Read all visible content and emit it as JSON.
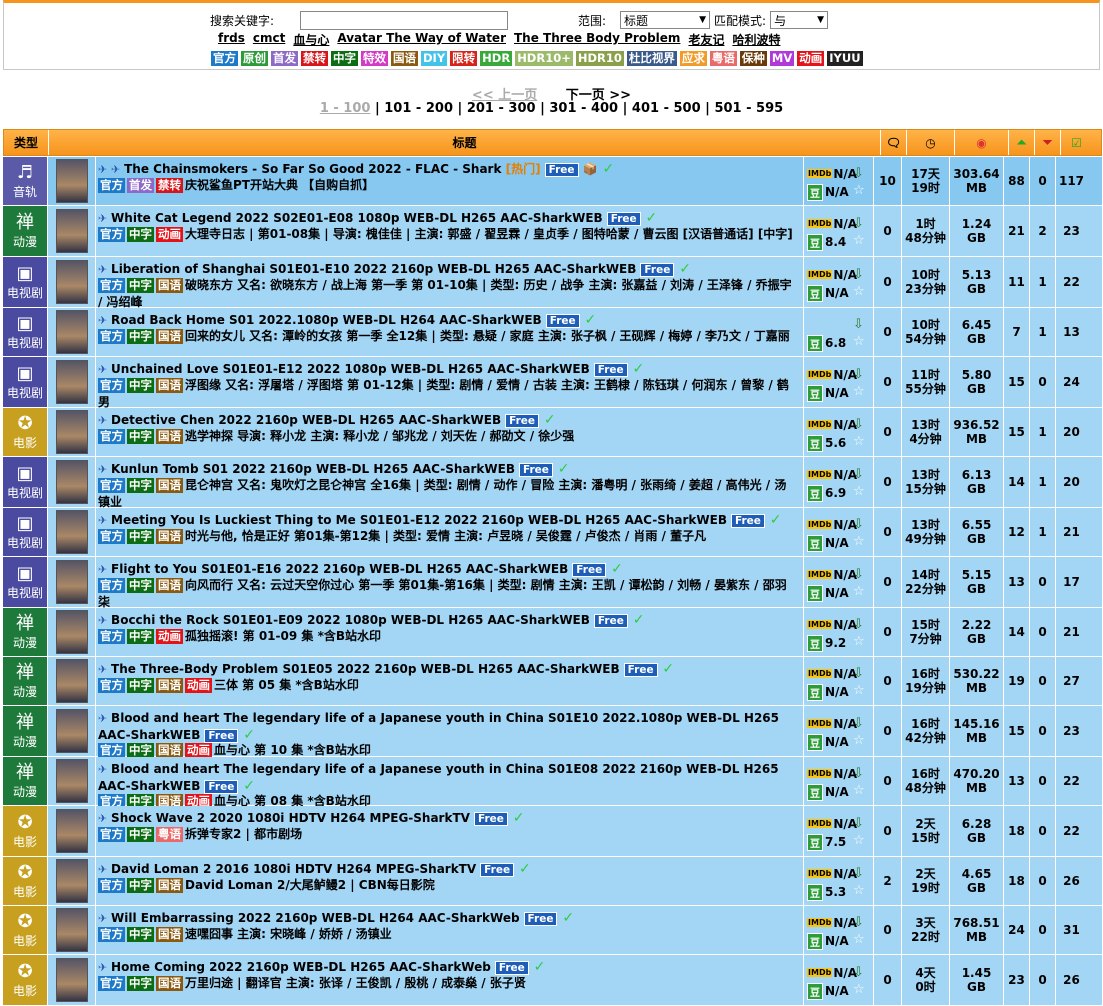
{
  "search": {
    "label": "搜索关键字:",
    "scope_label": "范围:",
    "scope_value": "标题",
    "mode_label": "匹配模式:",
    "mode_value": "与"
  },
  "hot": [
    "frds",
    "cmct",
    "血与心",
    "Avatar The Way of Water",
    "The Three Body Problem",
    "老友记",
    "哈利波特"
  ],
  "tags": [
    {
      "t": "官方",
      "c": "#1e7ac8"
    },
    {
      "t": "原创",
      "c": "#2c9c3a"
    },
    {
      "t": "首发",
      "c": "#8e6ac8"
    },
    {
      "t": "禁转",
      "c": "#d6161b"
    },
    {
      "t": "中字",
      "c": "#0d6d14"
    },
    {
      "t": "特效",
      "c": "#d43bc4"
    },
    {
      "t": "国语",
      "c": "#8a5a10"
    },
    {
      "t": "DIY",
      "c": "#43c3e8"
    },
    {
      "t": "限转",
      "c": "#d4241b"
    },
    {
      "t": "HDR",
      "c": "#39a93a"
    },
    {
      "t": "HDR10+",
      "c": "#9bba6a"
    },
    {
      "t": "HDR10",
      "c": "#8aa04a"
    },
    {
      "t": "杜比视界",
      "c": "#3a5a8a"
    },
    {
      "t": "应求",
      "c": "#f19c2a"
    },
    {
      "t": "粤语",
      "c": "#e86a6a"
    },
    {
      "t": "保种",
      "c": "#6a3a0a"
    },
    {
      "t": "MV",
      "c": "#b03ad8"
    },
    {
      "t": "动画",
      "c": "#e2141a"
    },
    {
      "t": "IYUU",
      "c": "#222"
    }
  ],
  "pager": {
    "prev": "<< 上一页",
    "next": "下一页 >>",
    "pages": [
      "1 - 100",
      "101 - 200",
      "201 - 300",
      "301 - 400",
      "401 - 500",
      "501 - 595"
    ]
  },
  "header": {
    "type": "类型",
    "title": "标题"
  },
  "rows": [
    {
      "cat": "音轨",
      "g": "♬",
      "cc": "#5a5aa8",
      "title": "The Chainsmokers - So Far So Good 2022 - FLAC - Shark",
      "hot": "[热门]",
      "sub": "庆祝鲨鱼PT开站大典 【自购自抓】",
      "tags": [
        "官方",
        "首发",
        "禁转"
      ],
      "imdb": "N/A",
      "db": "N/A",
      "c": "10",
      "time": "17天\n19时",
      "size": "303.64\nMB",
      "se": "88",
      "le": "0",
      "done": "117"
    },
    {
      "cat": "动漫",
      "g": "禅",
      "cc": "#1e7a3a",
      "title": "White Cat Legend 2022 S02E01-E08 1080p WEB-DL H265 AAC-SharkWEB",
      "sub": "大理寺日志 | 第01-08集 | 导演: 槐佳佳 | 主演: 郭盛 / 翟昱霖 / 皇贞季 / 图特哈蒙 / 曹云图 [汉语普通话] [中字]",
      "tags": [
        "官方",
        "中字",
        "动画"
      ],
      "imdb": "N/A",
      "db": "8.4",
      "c": "0",
      "time": "1时\n48分钟",
      "size": "1.24\nGB",
      "se": "21",
      "le": "2",
      "done": "23"
    },
    {
      "cat": "电视剧",
      "g": "▣",
      "cc": "#4a4aa0",
      "title": "Liberation of Shanghai S01E01-E10 2022 2160p WEB-DL H265 AAC-SharkWEB",
      "sub": "破晓东方 又名: 欲晓东方 / 战上海 第一季 第 01-10集 | 类型: 历史 / 战争 主演: 张嘉益 / 刘涛 / 王泽锋 / 乔振宇 / 冯绍峰",
      "tags": [
        "官方",
        "中字",
        "国语"
      ],
      "imdb": "N/A",
      "db": "N/A",
      "c": "0",
      "time": "10时\n23分钟",
      "size": "5.13\nGB",
      "se": "11",
      "le": "1",
      "done": "22"
    },
    {
      "cat": "电视剧",
      "g": "▣",
      "cc": "#4a4aa0",
      "title": "Road Back Home S01 2022.1080p WEB-DL H264 AAC-SharkWEB",
      "sub": "回来的女儿 又名: 潭岭的女孩 第一季 全12集 | 类型: 悬疑 / 家庭 主演: 张子枫 / 王砚辉 / 梅婷 / 李乃文 / 丁嘉丽",
      "tags": [
        "官方",
        "中字",
        "国语"
      ],
      "imdb": "",
      "db": "6.8",
      "c": "0",
      "time": "10时\n54分钟",
      "size": "6.45\nGB",
      "se": "7",
      "le": "1",
      "done": "13"
    },
    {
      "cat": "电视剧",
      "g": "▣",
      "cc": "#4a4aa0",
      "title": "Unchained Love S01E01-E12 2022 1080p WEB-DL H265 AAC-SharkWEB",
      "sub": "浮图缘 又名: 浮屠塔 / 浮图塔 第 01-12集 | 类型: 剧情 / 爱情 / 古装 主演: 王鹤棣 / 陈钰琪 / 何润东 / 曾黎 / 鹤男",
      "tags": [
        "官方",
        "中字",
        "国语"
      ],
      "imdb": "N/A",
      "db": "N/A",
      "c": "0",
      "time": "11时\n55分钟",
      "size": "5.80\nGB",
      "se": "15",
      "le": "0",
      "done": "24"
    },
    {
      "cat": "电影",
      "g": "✪",
      "cc": "#c8a020",
      "title": "Detective Chen 2022 2160p WEB-DL H265 AAC-SharkWEB",
      "sub": "逃学神探 导演: 释小龙 主演: 释小龙 / 邹兆龙 / 刘天佐 / 郝劭文 / 徐少强",
      "tags": [
        "官方",
        "中字",
        "国语"
      ],
      "imdb": "N/A",
      "db": "5.6",
      "c": "0",
      "time": "13时\n4分钟",
      "size": "936.52\nMB",
      "se": "15",
      "le": "1",
      "done": "20"
    },
    {
      "cat": "电视剧",
      "g": "▣",
      "cc": "#4a4aa0",
      "title": "Kunlun Tomb S01 2022 2160p WEB-DL H265 AAC-SharkWEB",
      "sub": "昆仑神宫 又名: 鬼吹灯之昆仑神宫 全16集 | 类型: 剧情 / 动作 / 冒险 主演: 潘粤明 / 张雨绮 / 姜超 / 高伟光 / 汤镇业",
      "tags": [
        "官方",
        "中字",
        "国语"
      ],
      "imdb": "N/A",
      "db": "6.9",
      "c": "0",
      "time": "13时\n15分钟",
      "size": "6.13\nGB",
      "se": "14",
      "le": "1",
      "done": "20"
    },
    {
      "cat": "电视剧",
      "g": "▣",
      "cc": "#4a4aa0",
      "title": "Meeting You Is Luckiest Thing to Me S01E01-E12 2022 2160p WEB-DL H265 AAC-SharkWEB",
      "sub": "时光与他, 恰是正好 第01集-第12集 | 类型: 爱情 主演: 卢昱晓 / 吴俊霆 / 卢俊杰 / 肖雨 / 董子凡",
      "tags": [
        "官方",
        "中字",
        "国语"
      ],
      "imdb": "N/A",
      "db": "N/A",
      "c": "0",
      "time": "13时\n49分钟",
      "size": "6.55\nGB",
      "se": "12",
      "le": "1",
      "done": "21"
    },
    {
      "cat": "电视剧",
      "g": "▣",
      "cc": "#4a4aa0",
      "title": "Flight to You S01E01-E16 2022 2160p WEB-DL H265 AAC-SharkWEB",
      "sub": "向风而行 又名: 云过天空你过心 第一季 第01集-第16集 | 类型: 剧情 主演: 王凯 / 谭松韵 / 刘畅 / 晏紫东 / 邵羽柒",
      "tags": [
        "官方",
        "中字",
        "国语"
      ],
      "imdb": "N/A",
      "db": "N/A",
      "c": "0",
      "time": "14时\n22分钟",
      "size": "5.15\nGB",
      "se": "13",
      "le": "0",
      "done": "17"
    },
    {
      "cat": "动漫",
      "g": "禅",
      "cc": "#1e7a3a",
      "title": "Bocchi the Rock S01E01-E09 2022 1080p WEB-DL H265 AAC-SharkWEB",
      "sub": "孤独摇滚! 第 01-09 集 *含B站水印",
      "tags": [
        "官方",
        "中字",
        "动画"
      ],
      "imdb": "N/A",
      "db": "9.2",
      "c": "0",
      "time": "15时\n7分钟",
      "size": "2.22\nGB",
      "se": "14",
      "le": "0",
      "done": "21"
    },
    {
      "cat": "动漫",
      "g": "禅",
      "cc": "#1e7a3a",
      "title": "The Three-Body Problem S01E05 2022 2160p WEB-DL H265 AAC-SharkWEB",
      "sub": "三体 第 05 集 *含B站水印",
      "tags": [
        "官方",
        "中字",
        "国语",
        "动画"
      ],
      "imdb": "N/A",
      "db": "N/A",
      "c": "0",
      "time": "16时\n19分钟",
      "size": "530.22\nMB",
      "se": "19",
      "le": "0",
      "done": "27"
    },
    {
      "cat": "动漫",
      "g": "禅",
      "cc": "#1e7a3a",
      "title": "Blood and heart The legendary life of a Japanese youth in China S01E10 2022.1080p WEB-DL H265 AAC-SharkWEB",
      "sub": "血与心 第 10 集 *含B站水印",
      "tags": [
        "官方",
        "中字",
        "国语",
        "动画"
      ],
      "imdb": "N/A",
      "db": "N/A",
      "c": "0",
      "time": "16时\n42分钟",
      "size": "145.16\nMB",
      "se": "15",
      "le": "0",
      "done": "23"
    },
    {
      "cat": "动漫",
      "g": "禅",
      "cc": "#1e7a3a",
      "title": "Blood and heart The legendary life of a Japanese youth in China S01E08 2022 2160p WEB-DL H265 AAC-SharkWEB",
      "sub": "血与心 第 08 集 *含B站水印",
      "tags": [
        "官方",
        "中字",
        "国语",
        "动画"
      ],
      "imdb": "N/A",
      "db": "N/A",
      "c": "0",
      "time": "16时\n48分钟",
      "size": "470.20\nMB",
      "se": "13",
      "le": "0",
      "done": "22"
    },
    {
      "cat": "电影",
      "g": "✪",
      "cc": "#c8a020",
      "title": "Shock Wave 2 2020 1080i HDTV H264 MPEG-SharkTV",
      "sub": "拆弹专家2 | 都市剧场",
      "tags": [
        "官方",
        "中字",
        "粤语"
      ],
      "imdb": "N/A",
      "db": "7.5",
      "c": "0",
      "time": "2天\n15时",
      "size": "6.28\nGB",
      "se": "18",
      "le": "0",
      "done": "22"
    },
    {
      "cat": "电影",
      "g": "✪",
      "cc": "#c8a020",
      "title": "David Loman 2 2016 1080i HDTV H264 MPEG-SharkTV",
      "sub": "David Loman 2/大尾鲈鳗2 | CBN每日影院",
      "tags": [
        "官方",
        "中字",
        "国语"
      ],
      "imdb": "N/A",
      "db": "5.3",
      "c": "2",
      "time": "2天\n19时",
      "size": "4.65\nGB",
      "se": "18",
      "le": "0",
      "done": "26"
    },
    {
      "cat": "电影",
      "g": "✪",
      "cc": "#c8a020",
      "title": "Will Embarrassing 2022 2160p WEB-DL H264 AAC-SharkWeb",
      "sub": "速嘿囧事 主演: 宋晓峰 / 娇娇 / 汤镇业",
      "tags": [
        "官方",
        "中字",
        "国语"
      ],
      "imdb": "N/A",
      "db": "N/A",
      "c": "0",
      "time": "3天\n22时",
      "size": "768.51\nMB",
      "se": "24",
      "le": "0",
      "done": "31"
    },
    {
      "cat": "电影",
      "g": "✪",
      "cc": "#c8a020",
      "title": "Home Coming 2022 2160p WEB-DL H265 AAC-SharkWeb",
      "sub": "万里归途 | 翻译官 主演: 张译 / 王俊凯 / 殷桃 / 成泰燊 / 张子贤",
      "tags": [
        "官方",
        "中字",
        "国语"
      ],
      "imdb": "N/A",
      "db": "N/A",
      "c": "0",
      "time": "4天\n0时",
      "size": "1.45\nGB",
      "se": "23",
      "le": "0",
      "done": "26"
    }
  ]
}
